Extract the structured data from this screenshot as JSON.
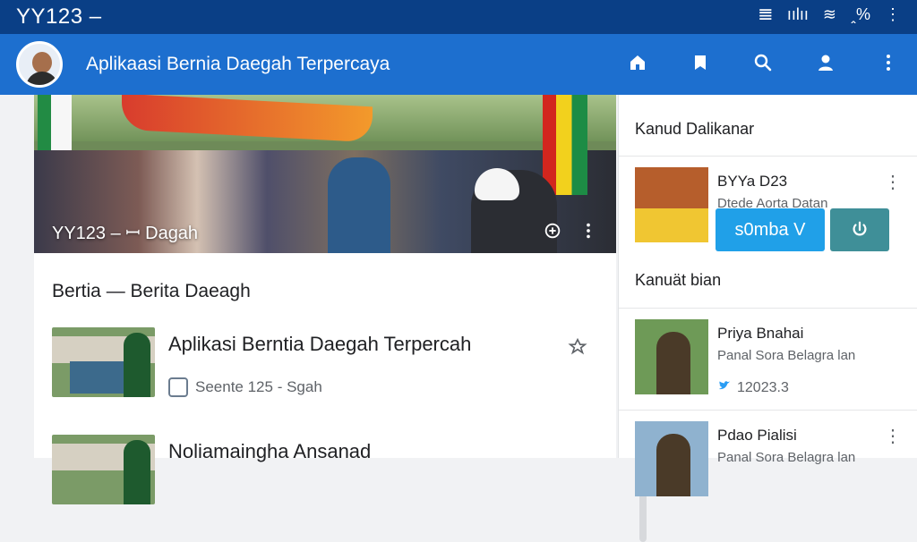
{
  "status": {
    "title": "YY123 –",
    "signal": "𝌆",
    "network": "ıılıı",
    "wifi": "≋",
    "battery_text": "ꞈ%"
  },
  "appbar": {
    "title": "Aplikaasi Bernia Daegah Terpercaya"
  },
  "hero": {
    "caption": "YY123 – ꟷ Dagah"
  },
  "main": {
    "section_title": "Bertia  —  Berita Daeagh",
    "articles": [
      {
        "headline": "Aplikasi Berntia Daegah Terpercah",
        "meta": "Seente 125 - Sgah"
      },
      {
        "headline": "Noliamaingha Ansanad",
        "meta": ""
      }
    ]
  },
  "sidebar": {
    "title1": "Kanud Dalikanar",
    "card1": {
      "name": "BYYa D23",
      "sub": "Dtede Aorta Datan",
      "primary": "s0mba V",
      "more": "⋮"
    },
    "title2": "Kanuät bian",
    "card2": {
      "name": "Priya Bnahai",
      "sub": "Panal Sora Belagra lan",
      "count": "12023.3"
    },
    "card3": {
      "name": "Pdao Pialisi",
      "sub": "Panal Sora Belagra lan"
    }
  }
}
